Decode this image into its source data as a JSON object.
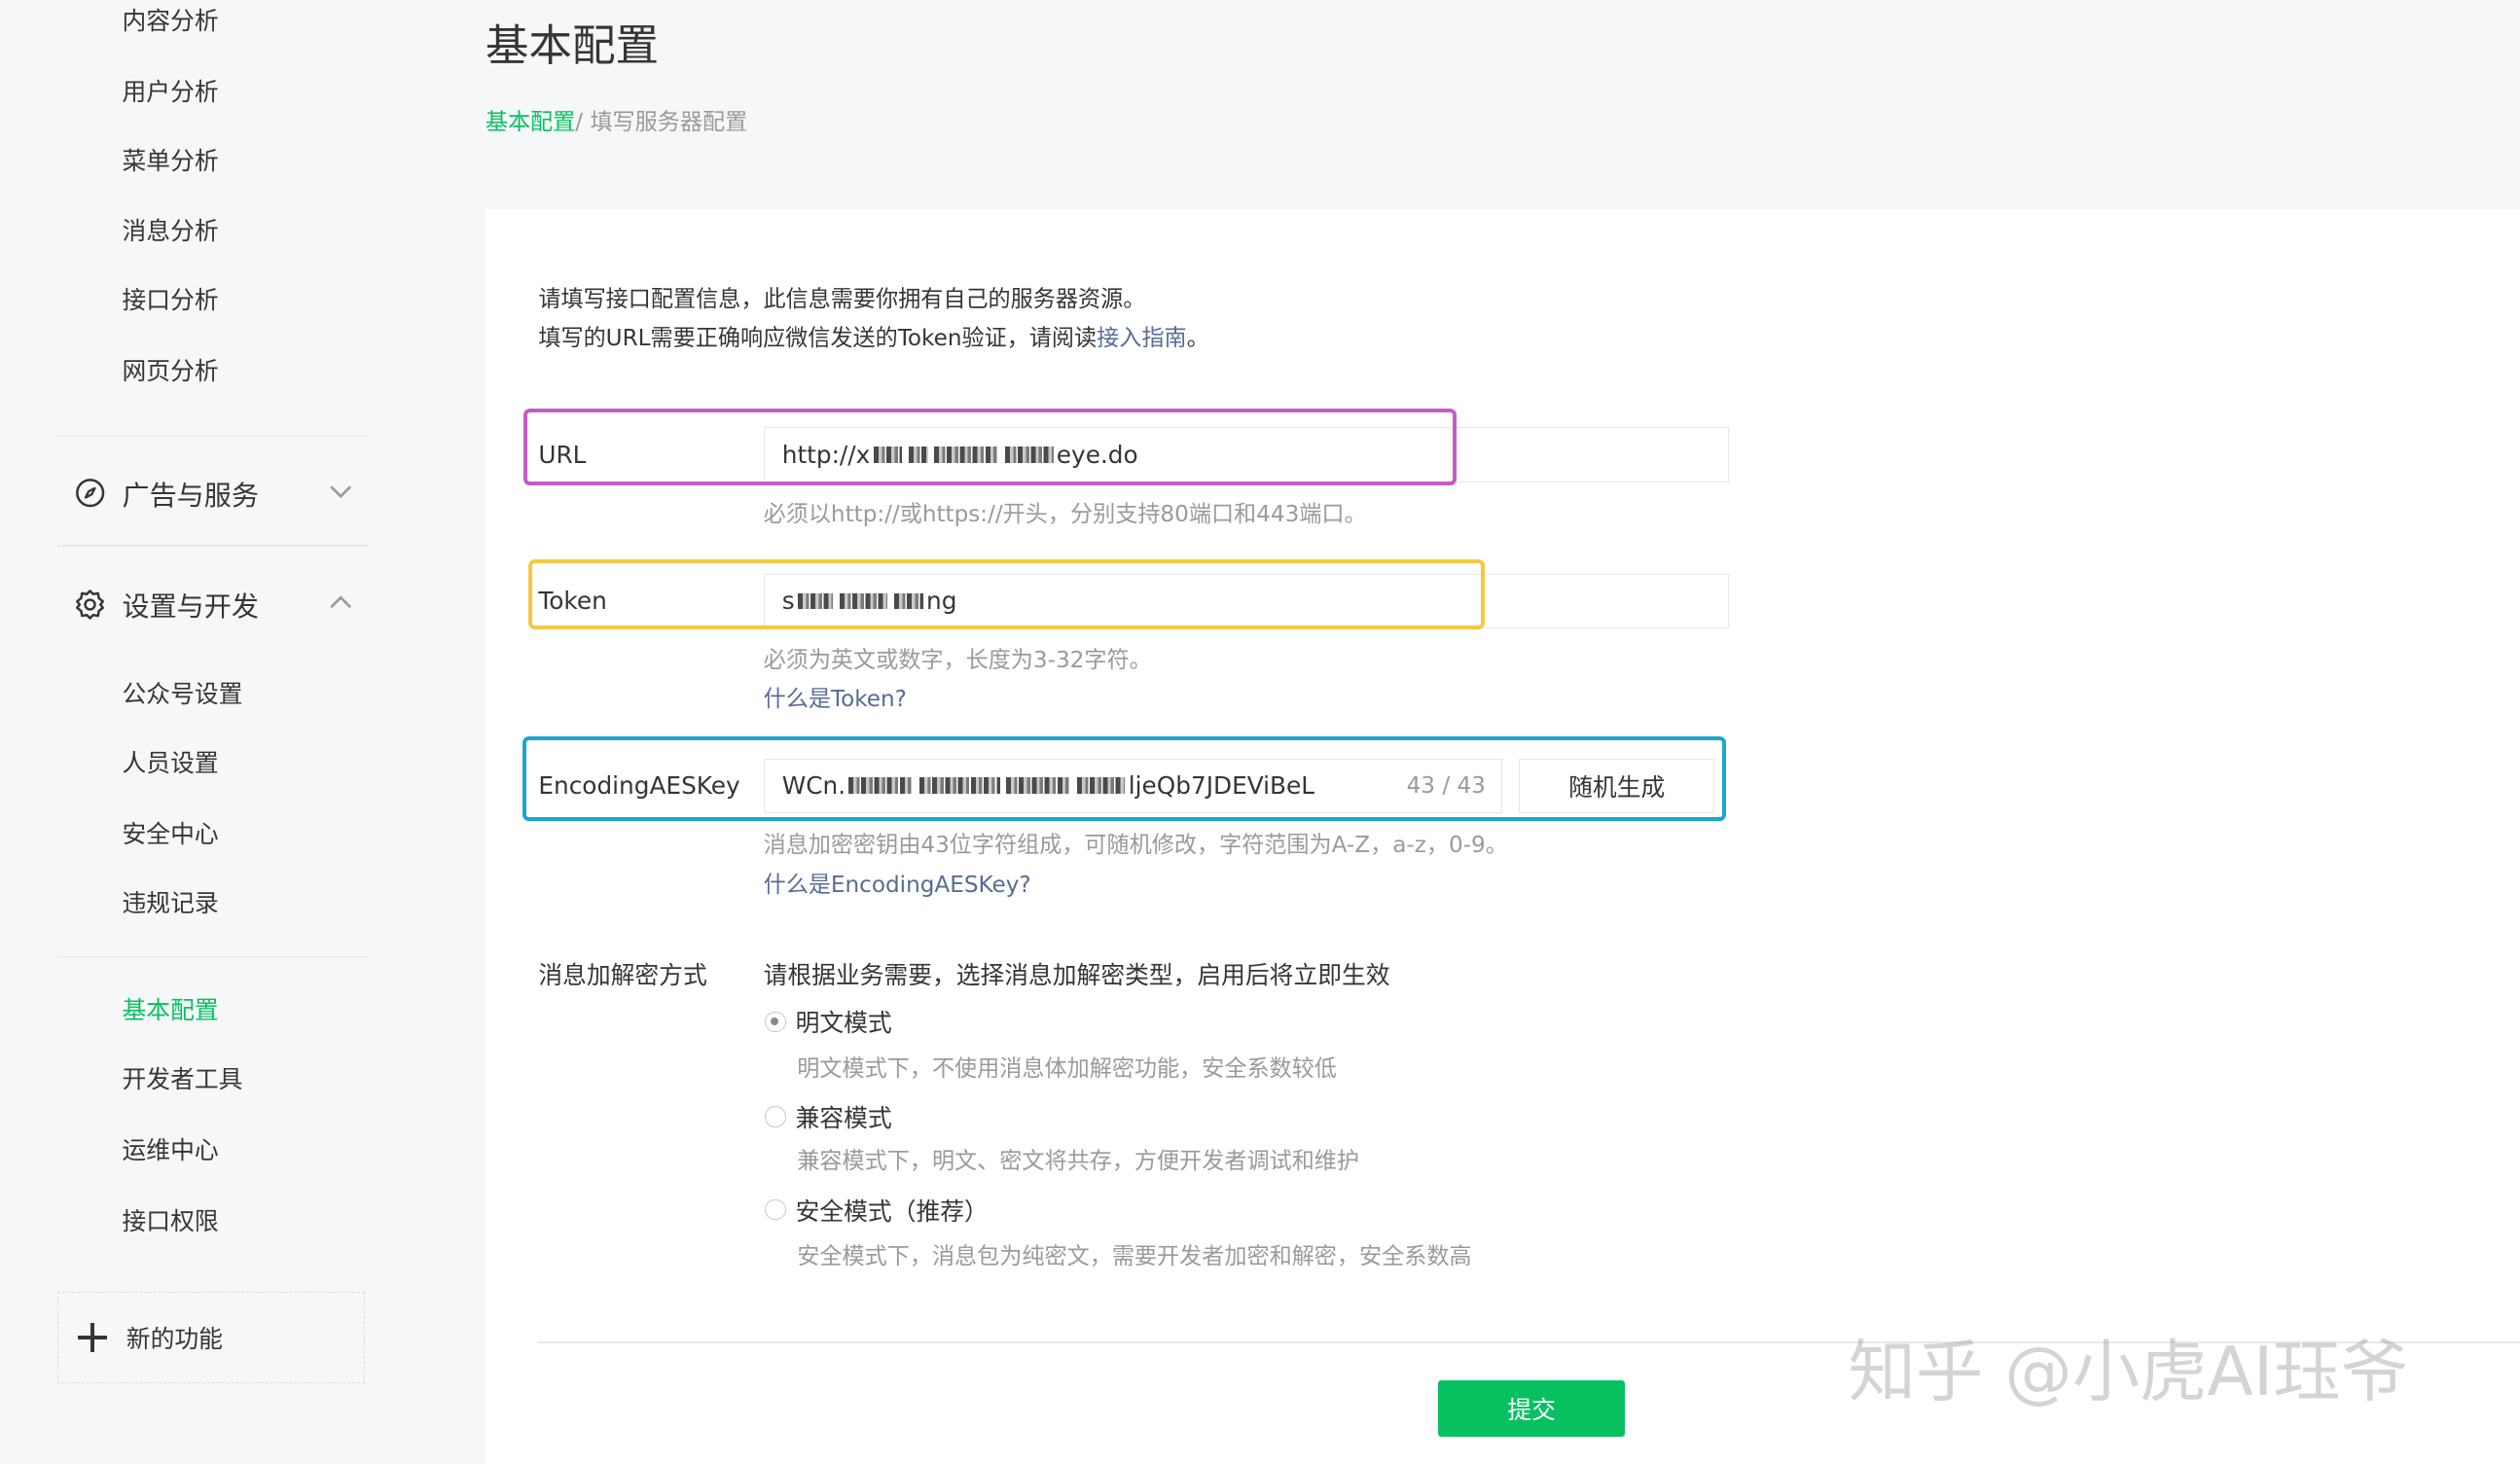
{
  "sidebar": {
    "analysis_items": [
      "内容分析",
      "用户分析",
      "菜单分析",
      "消息分析",
      "接口分析",
      "网页分析"
    ],
    "group_ads": {
      "label": "广告与服务",
      "icon": "compass-icon",
      "chevron": "chevron-down-icon"
    },
    "group_settings": {
      "label": "设置与开发",
      "icon": "gear-icon",
      "chevron": "chevron-up-icon"
    },
    "settings_items": [
      "公众号设置",
      "人员设置",
      "安全中心",
      "违规记录"
    ],
    "dev_items": [
      "基本配置",
      "开发者工具",
      "运维中心",
      "接口权限"
    ],
    "active_item": "基本配置",
    "new_feature": "新的功能"
  },
  "header": {
    "title": "基本配置",
    "breadcrumb_link": "基本配置",
    "breadcrumb_sep": "/",
    "breadcrumb_current": "填写服务器配置"
  },
  "intro": {
    "line1": "请填写接口配置信息，此信息需要你拥有自己的服务器资源。",
    "line2_prefix": "填写的URL需要正确响应微信发送的Token验证，请阅读",
    "line2_link": "接入指南",
    "line2_suffix": "。"
  },
  "form": {
    "url": {
      "label": "URL",
      "value_prefix": "http://x",
      "value_suffix": "eye.do",
      "hint": "必须以http://或https://开头，分别支持80端口和443端口。"
    },
    "token": {
      "label": "Token",
      "value_prefix": "s",
      "value_suffix": "ng",
      "hint": "必须为英文或数字，长度为3-32字符。",
      "help": "什么是Token?"
    },
    "aes": {
      "label": "EncodingAESKey",
      "value_prefix": "WCn.",
      "value_suffix": "ljeQb7JDEViBeL",
      "counter": "43 / 43",
      "generate": "随机生成",
      "hint": "消息加密密钥由43位字符组成，可随机修改，字符范围为A-Z，a-z，0-9。",
      "help": "什么是EncodingAESKey?"
    },
    "encryption": {
      "label": "消息加解密方式",
      "description": "请根据业务需要，选择消息加解密类型，启用后将立即生效",
      "options": [
        {
          "label": "明文模式",
          "desc": "明文模式下，不使用消息体加解密功能，安全系数较低",
          "checked": true
        },
        {
          "label": "兼容模式",
          "desc": "兼容模式下，明文、密文将共存，方便开发者调试和维护",
          "checked": false
        },
        {
          "label": "安全模式（推荐）",
          "desc": "安全模式下，消息包为纯密文，需要开发者加密和解密，安全系数高",
          "checked": false
        }
      ]
    },
    "submit": "提交"
  },
  "highlight_colors": {
    "url": "#c45cc7",
    "token": "#f5c842",
    "aes": "#1aa6cf"
  },
  "accent_color": "#07c160",
  "watermark": "知乎 @小虎AI珏爷"
}
